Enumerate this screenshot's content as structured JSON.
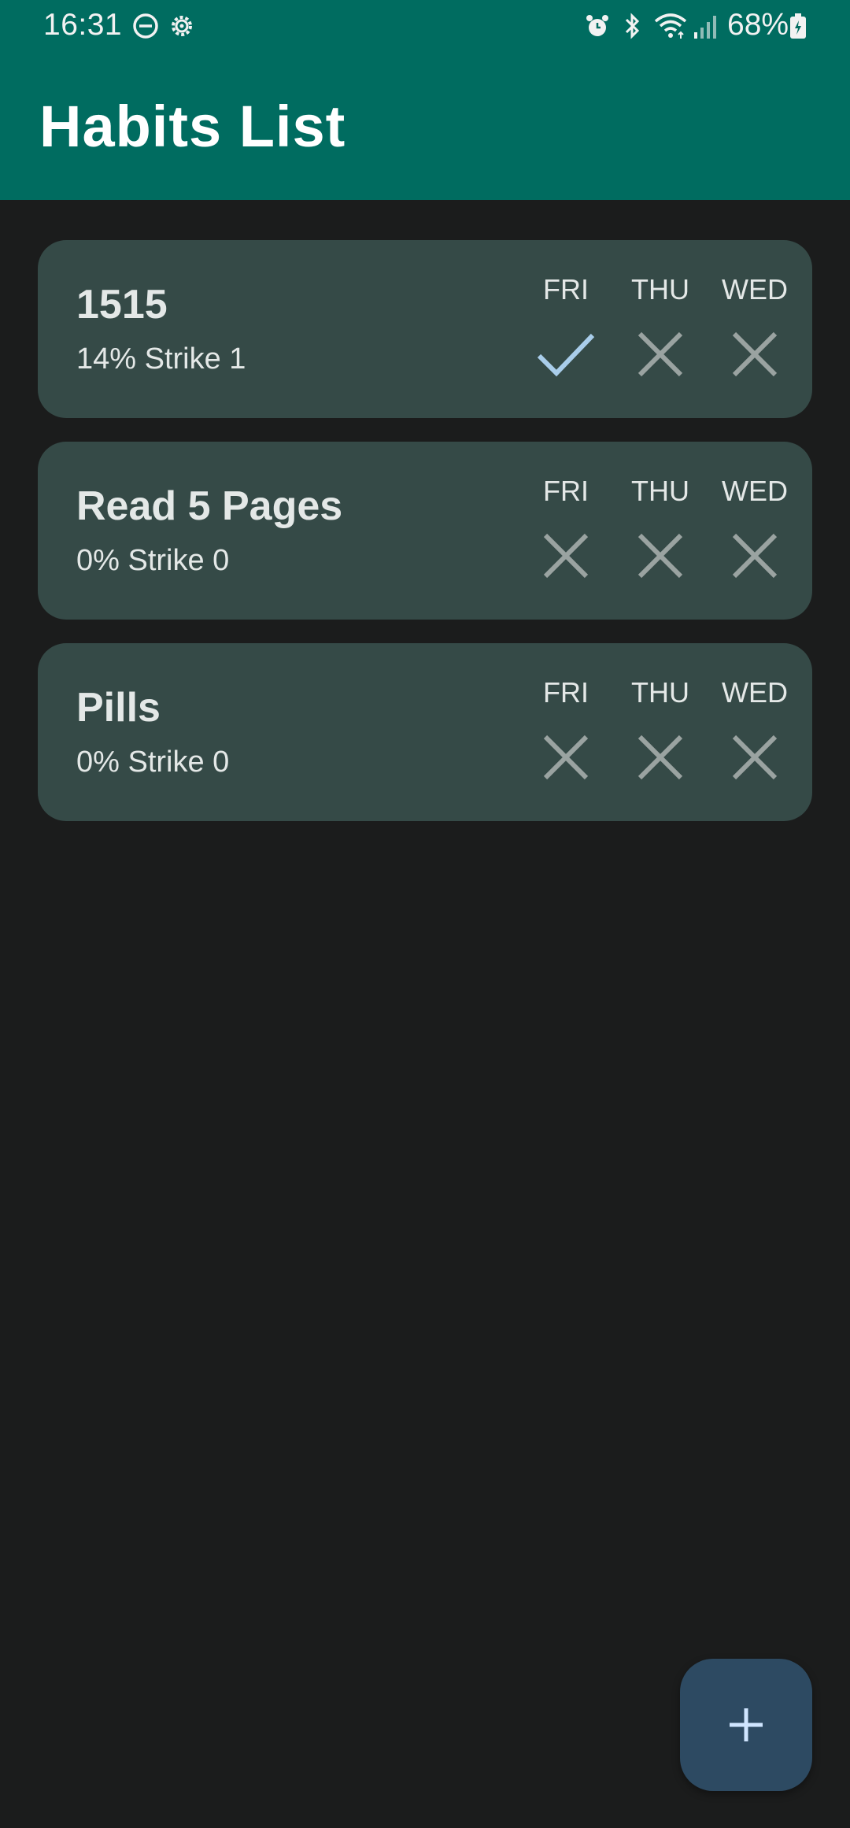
{
  "status_bar": {
    "time": "16:31",
    "battery": "68%",
    "icons": [
      "do-not-disturb-icon",
      "settings-icon",
      "alarm-icon",
      "bluetooth-icon",
      "wifi-icon",
      "signal-icon",
      "battery-icon"
    ]
  },
  "app_bar": {
    "title": "Habits List"
  },
  "habits": [
    {
      "name": "1515",
      "meta": "14% Strike 1",
      "days": [
        {
          "label": "FRI",
          "done": true
        },
        {
          "label": "THU",
          "done": false
        },
        {
          "label": "WED",
          "done": false
        }
      ]
    },
    {
      "name": "Read 5 Pages",
      "meta": "0% Strike 0",
      "days": [
        {
          "label": "FRI",
          "done": false
        },
        {
          "label": "THU",
          "done": false
        },
        {
          "label": "WED",
          "done": false
        }
      ]
    },
    {
      "name": "Pills",
      "meta": "0% Strike 0",
      "days": [
        {
          "label": "FRI",
          "done": false
        },
        {
          "label": "THU",
          "done": false
        },
        {
          "label": "WED",
          "done": false
        }
      ]
    }
  ],
  "fab": {
    "icon": "plus-icon"
  },
  "colors": {
    "app_bar": "#006c60",
    "background": "#1b1c1c",
    "card": "#354a47",
    "check": "#a9cdea",
    "cross": "#9aa3a1",
    "fab": "#2d4a62"
  }
}
